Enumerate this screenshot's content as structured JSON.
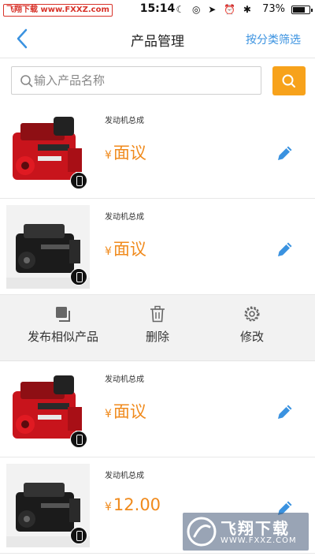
{
  "status_bar": {
    "watermark": "飞翔下载 www.FXXZ.com",
    "time": "15:14",
    "status_icons": "☾ ◎ ➤ ⏰ ✱",
    "battery_text": "73%",
    "battery_level": 0.73
  },
  "nav": {
    "title": "产品管理",
    "filter": "按分类筛选",
    "back_icon": "chevron-left-icon"
  },
  "search": {
    "value": "",
    "placeholder": "输入产品名称"
  },
  "products": [
    {
      "category": "发动机总成",
      "currency": "¥",
      "price": "面议",
      "engine_color": "red"
    },
    {
      "category": "发动机总成",
      "currency": "¥",
      "price": "面议",
      "engine_color": "black"
    },
    {
      "category": "发动机总成",
      "currency": "¥",
      "price": "面议",
      "engine_color": "red"
    },
    {
      "category": "发动机总成",
      "currency": "¥",
      "price": "12.00",
      "engine_color": "black"
    }
  ],
  "actions": {
    "publish_similar": "发布相似产品",
    "delete": "删除",
    "modify": "修改"
  },
  "watermark_bottom": {
    "text": "飞翔下载",
    "url": "WWW.FXXZ.COM"
  },
  "colors": {
    "accent_blue": "#3a92e0",
    "accent_orange": "#f7a21b",
    "price_orange": "#f08a1c"
  }
}
